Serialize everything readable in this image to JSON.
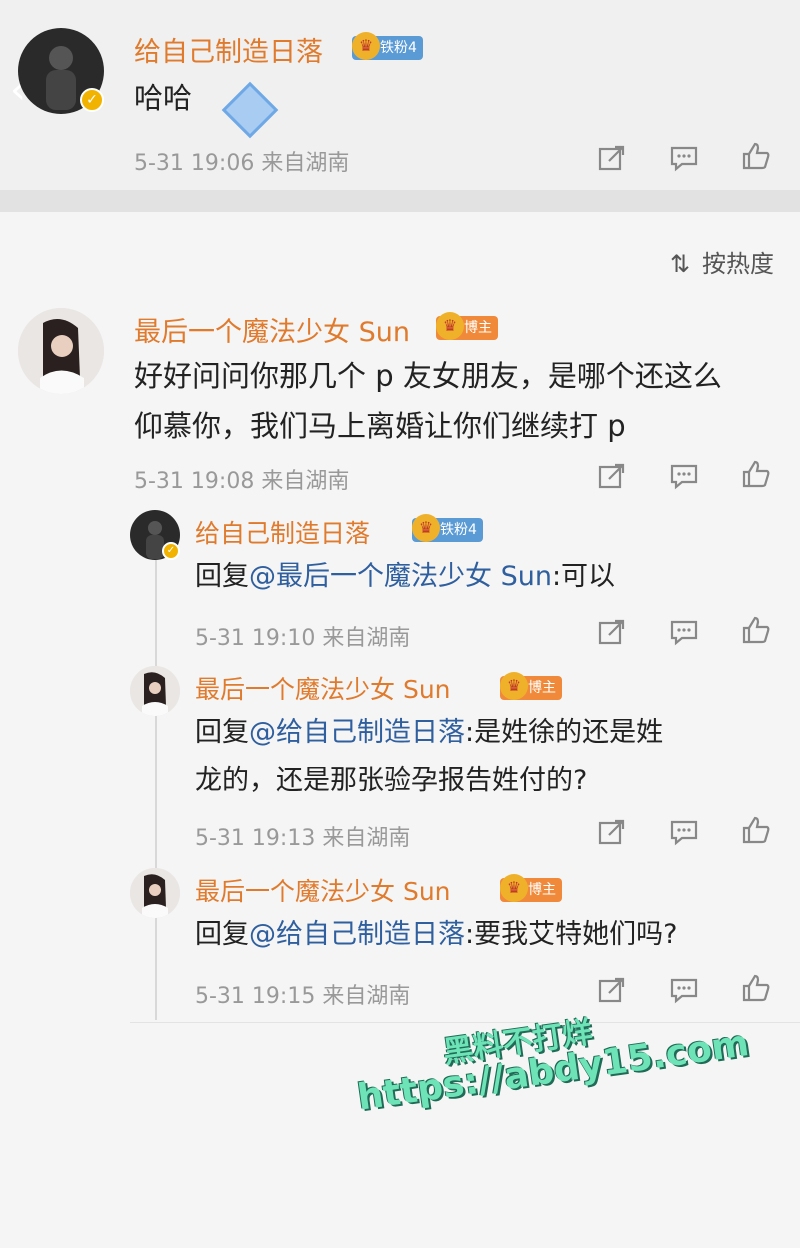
{
  "top_comment": {
    "username": "给自己制造日落",
    "badge": "铁粉4",
    "text": "哈哈",
    "meta": "5-31 19:06  来自湖南"
  },
  "sort_label": "按热度",
  "comments": [
    {
      "username": "最后一个魔法少女 Sun",
      "badge": "博主",
      "text_line1": "好好问问你那几个 p 友女朋友，是哪个还这么",
      "text_line2": "仰慕你，我们马上离婚让你们继续打 p",
      "meta": "5-31 19:08  来自湖南"
    }
  ],
  "replies": [
    {
      "username": "给自己制造日落",
      "badge": "铁粉4",
      "prefix": "回复",
      "mention": "@最后一个魔法少女 Sun",
      "text": ":可以",
      "meta": "5-31 19:10  来自湖南"
    },
    {
      "username": "最后一个魔法少女 Sun",
      "badge": "博主",
      "prefix": "回复",
      "mention": "@给自己制造日落",
      "text": ":是姓徐的还是姓",
      "text_line2": "龙的，还是那张验孕报告姓付的?",
      "meta": "5-31 19:13  来自湖南"
    },
    {
      "username": "最后一个魔法少女 Sun",
      "badge": "博主",
      "prefix": "回复",
      "mention": "@给自己制造日落",
      "text": ":要我艾特她们吗?",
      "meta": "5-31 19:15  来自湖南"
    }
  ],
  "watermark": {
    "line1": "黑料不打烊",
    "line2": "https://abdy15.com"
  },
  "colors": {
    "username": "#e07a2c",
    "mention": "#2f5f9e",
    "meta": "#999999",
    "watermark": "#6fe3b8"
  },
  "icons": [
    "back-icon",
    "share-icon",
    "comment-icon",
    "like-icon",
    "sort-icon",
    "verified-icon",
    "crown-icon"
  ]
}
